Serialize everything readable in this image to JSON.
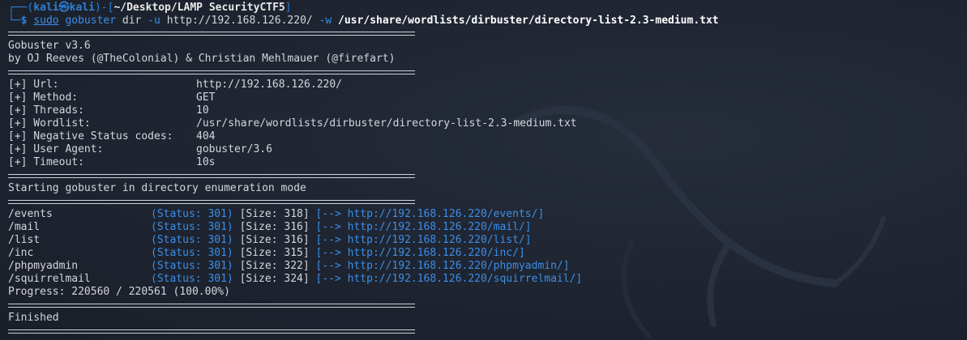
{
  "prompt": {
    "corner_top": "┌──(",
    "user": "kali",
    "at": "㉿",
    "host": "kali",
    "mid": ")-[",
    "path": "~/Desktop/LAMP SecurityCTF5",
    "close": "]",
    "corner_bottom": "└─",
    "dollar": "$"
  },
  "command": {
    "sudo": "sudo",
    "bin": "gobuster",
    "subcommand": "dir",
    "flag_u": "-u",
    "url": "http://192.168.126.220/",
    "flag_w": "-w",
    "wordlist": "/usr/share/wordlists/dirbuster/directory-list-2.3-medium.txt"
  },
  "banner": {
    "title": "Gobuster v3.6",
    "authors": "by OJ Reeves (@TheColonial) & Christian Mehlmauer (@firefart)"
  },
  "config": [
    {
      "key": "[+] Url:",
      "value": "http://192.168.126.220/"
    },
    {
      "key": "[+] Method:",
      "value": "GET"
    },
    {
      "key": "[+] Threads:",
      "value": "10"
    },
    {
      "key": "[+] Wordlist:",
      "value": "/usr/share/wordlists/dirbuster/directory-list-2.3-medium.txt"
    },
    {
      "key": "[+] Negative Status codes:",
      "value": "404"
    },
    {
      "key": "[+] User Agent:",
      "value": "gobuster/3.6"
    },
    {
      "key": "[+] Timeout:",
      "value": "10s"
    }
  ],
  "mode_text": "Starting gobuster in directory enumeration mode",
  "results": [
    {
      "path": "/events",
      "status": "(Status: 301)",
      "size": "[Size: 318]",
      "arrow": "[-->",
      "redirect": "http://192.168.126.220/events/]"
    },
    {
      "path": "/mail",
      "status": "(Status: 301)",
      "size": "[Size: 316]",
      "arrow": "[-->",
      "redirect": "http://192.168.126.220/mail/]"
    },
    {
      "path": "/list",
      "status": "(Status: 301)",
      "size": "[Size: 316]",
      "arrow": "[-->",
      "redirect": "http://192.168.126.220/list/]"
    },
    {
      "path": "/inc",
      "status": "(Status: 301)",
      "size": "[Size: 315]",
      "arrow": "[-->",
      "redirect": "http://192.168.126.220/inc/]"
    },
    {
      "path": "/phpmyadmin",
      "status": "(Status: 301)",
      "size": "[Size: 322]",
      "arrow": "[-->",
      "redirect": "http://192.168.126.220/phpmyadmin/]"
    },
    {
      "path": "/squirrelmail",
      "status": "(Status: 301)",
      "size": "[Size: 324]",
      "arrow": "[-->",
      "redirect": "http://192.168.126.220/squirrelmail/]"
    }
  ],
  "progress": "Progress: 220560 / 220561 (100.00%)",
  "finished": "Finished",
  "colors": {
    "background": "#1e2430",
    "accent_blue": "#3c8ee8",
    "text": "#d4d6db"
  }
}
